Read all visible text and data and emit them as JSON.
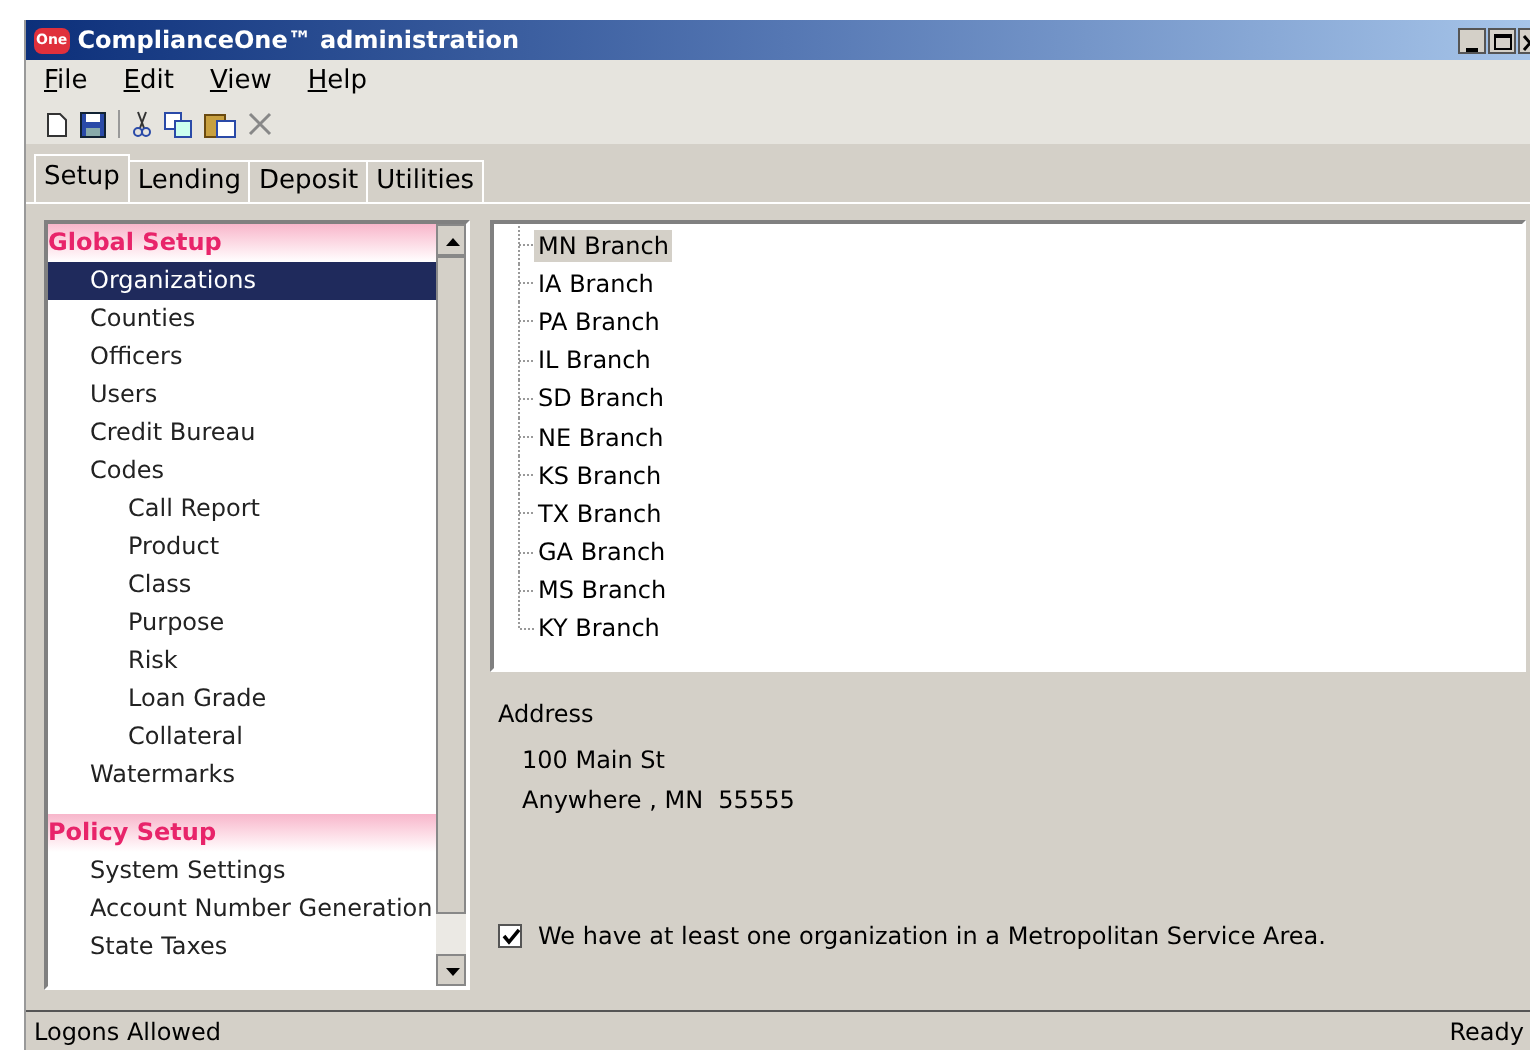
{
  "window": {
    "title": "ComplianceOne™ administration",
    "logo": "One"
  },
  "menu": [
    {
      "label": "File"
    },
    {
      "label": "Edit"
    },
    {
      "label": "View"
    },
    {
      "label": "Help"
    }
  ],
  "tabs": [
    {
      "label": "Setup",
      "selected": true
    },
    {
      "label": "Lending",
      "selected": false
    },
    {
      "label": "Deposit",
      "selected": false
    },
    {
      "label": "Utilities",
      "selected": false
    }
  ],
  "sidebar": {
    "sections": [
      {
        "title": "Global Setup",
        "items": [
          {
            "label": "Organizations",
            "selected": true
          },
          {
            "label": "Counties",
            "selected": false
          },
          {
            "label": "Officers",
            "selected": false
          },
          {
            "label": "Users",
            "selected": false
          },
          {
            "label": "Credit Bureau",
            "selected": false
          },
          {
            "label": "Codes",
            "selected": false,
            "children": [
              {
                "label": "Call Report",
                "selected": false
              },
              {
                "label": "Product",
                "selected": false
              },
              {
                "label": "Class",
                "selected": false
              },
              {
                "label": "Purpose",
                "selected": false
              },
              {
                "label": "Risk",
                "selected": false
              },
              {
                "label": "Loan Grade",
                "selected": false
              },
              {
                "label": "Collateral",
                "selected": false
              }
            ]
          },
          {
            "label": "Watermarks",
            "selected": false
          }
        ]
      },
      {
        "title": "Policy Setup",
        "items": [
          {
            "label": "System Settings",
            "selected": false
          },
          {
            "label": "Account Number Generation",
            "selected": false
          },
          {
            "label": "State Taxes",
            "selected": false
          }
        ]
      }
    ]
  },
  "tree": {
    "items": [
      {
        "label": "MN Branch",
        "selected": true
      },
      {
        "label": "IA Branch",
        "selected": false
      },
      {
        "label": "PA Branch",
        "selected": false
      },
      {
        "label": "IL Branch",
        "selected": false
      },
      {
        "label": "SD Branch",
        "selected": false
      },
      {
        "label": "NE Branch",
        "selected": false
      },
      {
        "label": "KS Branch",
        "selected": false
      },
      {
        "label": "TX Branch",
        "selected": false
      },
      {
        "label": "GA Branch",
        "selected": false
      },
      {
        "label": "MS Branch",
        "selected": false
      },
      {
        "label": "KY Branch",
        "selected": false
      }
    ]
  },
  "address": {
    "label": "Address",
    "lines": [
      "100 Main St",
      "Anywhere , MN  55555"
    ]
  },
  "msa_checkbox": {
    "label": "We have at least one organization in a Metropolitan Service Area.",
    "checked": true
  },
  "status_bar": {
    "left": "Logons Allowed",
    "right": "Ready"
  }
}
